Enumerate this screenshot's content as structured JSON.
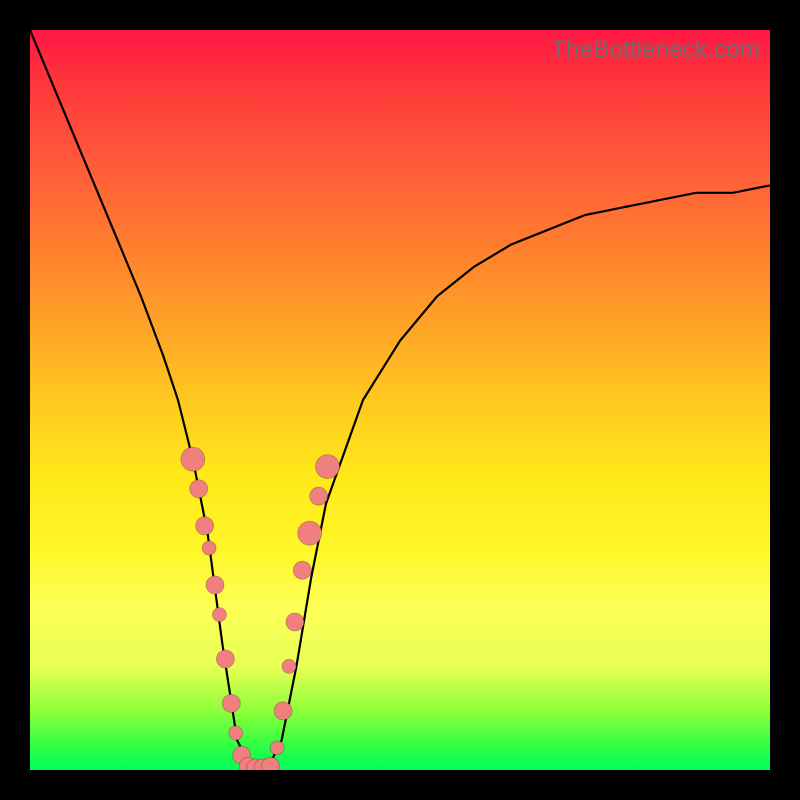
{
  "watermark": "TheBottleneck.com",
  "chart_data": {
    "type": "line",
    "title": "",
    "xlabel": "",
    "ylabel": "",
    "xlim": [
      0,
      100
    ],
    "ylim": [
      0,
      100
    ],
    "grid": false,
    "series": [
      {
        "name": "bottleneck-curve",
        "x": [
          0,
          5,
          10,
          15,
          18,
          20,
          22,
          24,
          26,
          28,
          30,
          32,
          34,
          36,
          38,
          40,
          45,
          50,
          55,
          60,
          65,
          70,
          75,
          80,
          85,
          90,
          95,
          100
        ],
        "y": [
          100,
          88,
          76,
          64,
          56,
          50,
          42,
          32,
          17,
          4,
          0,
          0,
          4,
          14,
          26,
          36,
          50,
          58,
          64,
          68,
          71,
          73,
          75,
          76,
          77,
          78,
          78,
          79
        ]
      }
    ],
    "points_left": [
      {
        "x": 22.0,
        "y": 42,
        "size": "big"
      },
      {
        "x": 22.8,
        "y": 38,
        "size": "med"
      },
      {
        "x": 23.6,
        "y": 33,
        "size": "med"
      },
      {
        "x": 24.2,
        "y": 30,
        "size": "sm"
      },
      {
        "x": 25.0,
        "y": 25,
        "size": "med"
      },
      {
        "x": 25.6,
        "y": 21,
        "size": "sm"
      },
      {
        "x": 26.4,
        "y": 15,
        "size": "med"
      },
      {
        "x": 27.2,
        "y": 9,
        "size": "med"
      },
      {
        "x": 27.8,
        "y": 5,
        "size": "sm"
      },
      {
        "x": 28.6,
        "y": 2,
        "size": "med"
      }
    ],
    "points_bottom": [
      {
        "x": 29.5,
        "y": 0.5,
        "size": "med"
      },
      {
        "x": 30.5,
        "y": 0.3,
        "size": "med"
      },
      {
        "x": 31.5,
        "y": 0.3,
        "size": "med"
      },
      {
        "x": 32.5,
        "y": 0.5,
        "size": "med"
      }
    ],
    "points_right": [
      {
        "x": 33.4,
        "y": 3,
        "size": "sm"
      },
      {
        "x": 34.2,
        "y": 8,
        "size": "med"
      },
      {
        "x": 35.0,
        "y": 14,
        "size": "sm"
      },
      {
        "x": 35.8,
        "y": 20,
        "size": "med"
      },
      {
        "x": 36.8,
        "y": 27,
        "size": "med"
      },
      {
        "x": 37.8,
        "y": 32,
        "size": "big"
      },
      {
        "x": 39.0,
        "y": 37,
        "size": "med"
      },
      {
        "x": 40.2,
        "y": 41,
        "size": "big"
      }
    ]
  }
}
